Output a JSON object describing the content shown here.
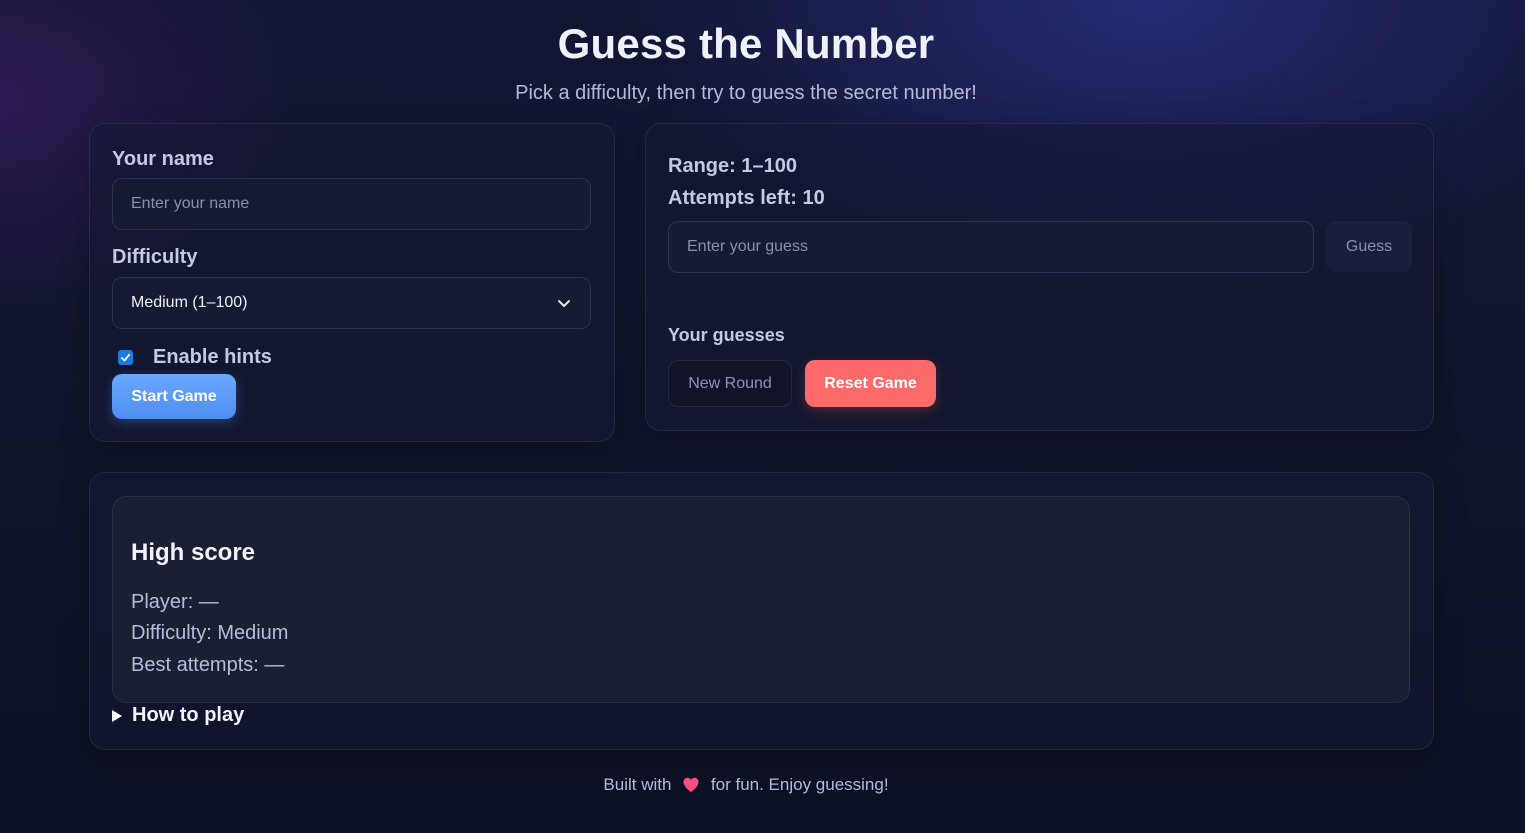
{
  "header": {
    "title": "Guess the Number",
    "subtitle": "Pick a difficulty, then try to guess the secret number!"
  },
  "setup": {
    "name_label": "Your name",
    "name_placeholder": "Enter your name",
    "name_value": "",
    "difficulty_label": "Difficulty",
    "difficulty_selected": "Medium (1–100)",
    "hints_checked": true,
    "hints_label": "Enable hints",
    "start_label": "Start Game"
  },
  "game": {
    "range_text": "Range: 1–100",
    "attempts_text": "Attempts left: 10",
    "guess_placeholder": "Enter your guess",
    "guess_button": "Guess",
    "guesses_label": "Your guesses",
    "new_round_label": "New Round",
    "reset_label": "Reset Game"
  },
  "high_score": {
    "title": "High score",
    "player": "Player: —",
    "difficulty": "Difficulty: Medium",
    "best_attempts": "Best attempts: —"
  },
  "how_to_play": {
    "label": "How to play",
    "expanded": false
  },
  "footer": {
    "before": "Built with",
    "icon": "heart-icon",
    "after": "for fun. Enjoy guessing!"
  },
  "colors": {
    "accent_blue": "#5b9bf8",
    "reset_red": "#ff6b6b",
    "checkbox_blue": "#1f7ae0",
    "heart": "#ff4d7d"
  }
}
